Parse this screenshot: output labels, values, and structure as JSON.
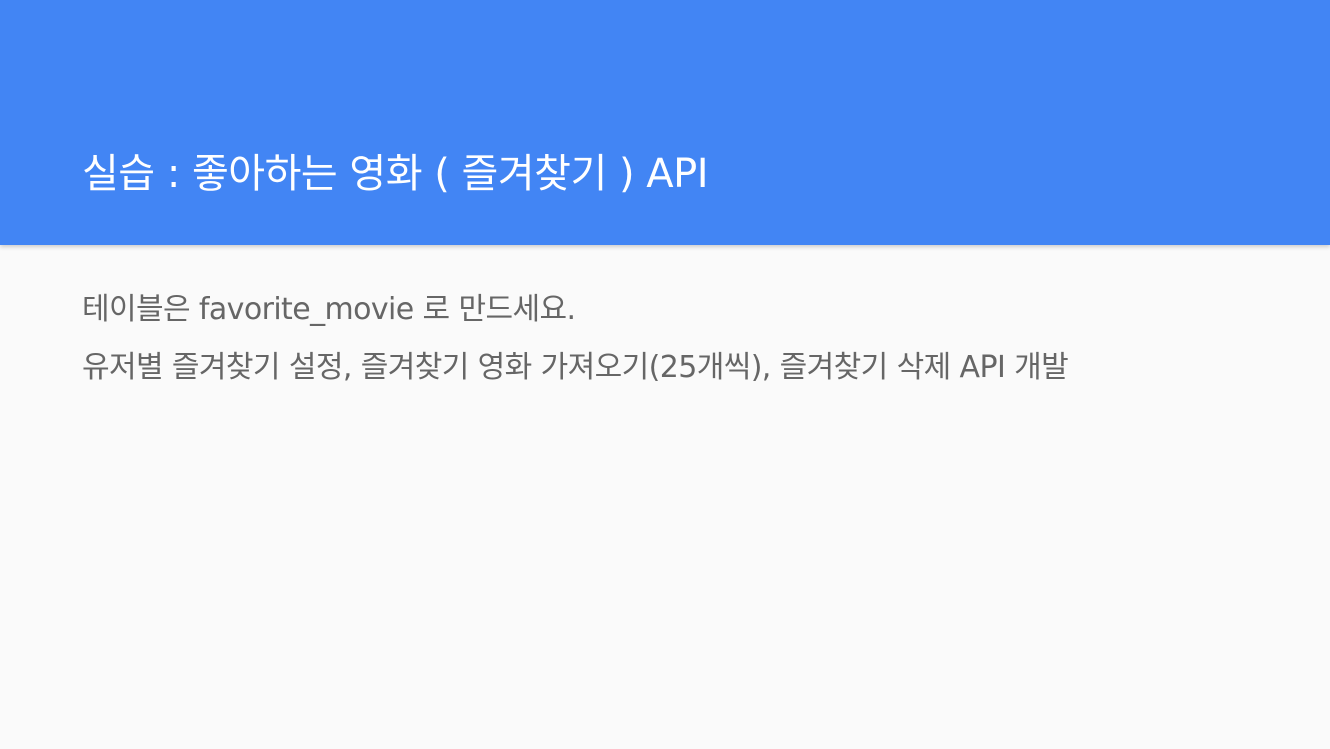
{
  "slide": {
    "title": "실습 : 좋아하는 영화 ( 즐겨찾기 ) API",
    "paragraphs": [
      "테이블은 favorite_movie 로 만드세요.",
      "유저별 즐겨찾기 설정,  즐겨찾기 영화 가져오기(25개씩), 즐겨찾기 삭제   API 개발"
    ]
  },
  "colors": {
    "header_bg": "#4285f4",
    "page_bg": "#fafafa",
    "title_text": "#ffffff",
    "body_text": "#666666"
  }
}
